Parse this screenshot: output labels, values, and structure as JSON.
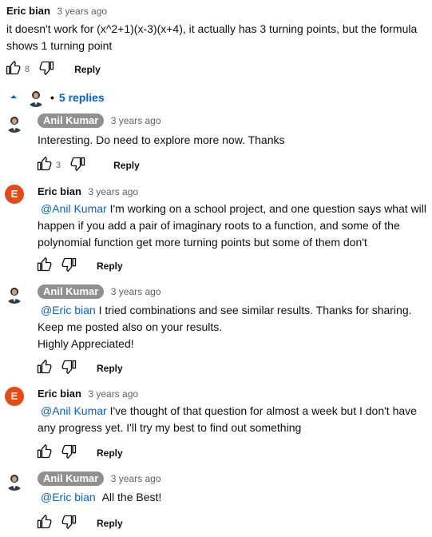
{
  "colors": {
    "link": "#065fd4",
    "author_pill": "#909090",
    "avatar_e": "#e64a19",
    "secondary_text": "#606060"
  },
  "top_comment": {
    "author": "Eric bian",
    "time": "3 years ago",
    "text_line1": "it doesn't work for (x^2+1)(x-3)(x+4), it actually has 3 turning points, but the formula",
    "text_line2": "shows 1 turning point",
    "likes": "8",
    "reply_label": "Reply"
  },
  "replies_toggle": {
    "label": "5 replies"
  },
  "replies": [
    {
      "author": "Anil Kumar",
      "time": "3 years ago",
      "lines": [
        "Interesting. Do need to explore more now. Thanks"
      ],
      "likes": "3",
      "reply_label": "Reply"
    },
    {
      "author": "Eric bian",
      "avatar_letter": "E",
      "time": "3 years ago",
      "mention": "@Anil Kumar",
      "line1_rest": "I'm working on a school project, and one question says what will",
      "line2": "happen if you add a pair of imaginary roots to a function, and  some of the",
      "line3": "polynomial function  get more turning points but some of them don't",
      "reply_label": "Reply"
    },
    {
      "author": "Anil Kumar",
      "time": "3 years ago",
      "mention": "@Eric bian",
      "line1_rest": "I tried combinations and see similar results. Thanks for sharing.",
      "line2": "Keep me posted also on your results.",
      "line3": "Highly Appreciated!",
      "reply_label": "Reply"
    },
    {
      "author": "Eric bian",
      "avatar_letter": "E",
      "time": "3 years ago",
      "mention": "@Anil Kumar",
      "line1_rest": "I've thought of that question for almost a week but I don't have",
      "line2": "any progress yet. I'll try my best to find out something",
      "reply_label": "Reply"
    },
    {
      "author": "Anil Kumar",
      "time": "3 years ago",
      "mention": "@Eric bian",
      "line1_rest": "All the Best!",
      "reply_label": "Reply"
    }
  ]
}
